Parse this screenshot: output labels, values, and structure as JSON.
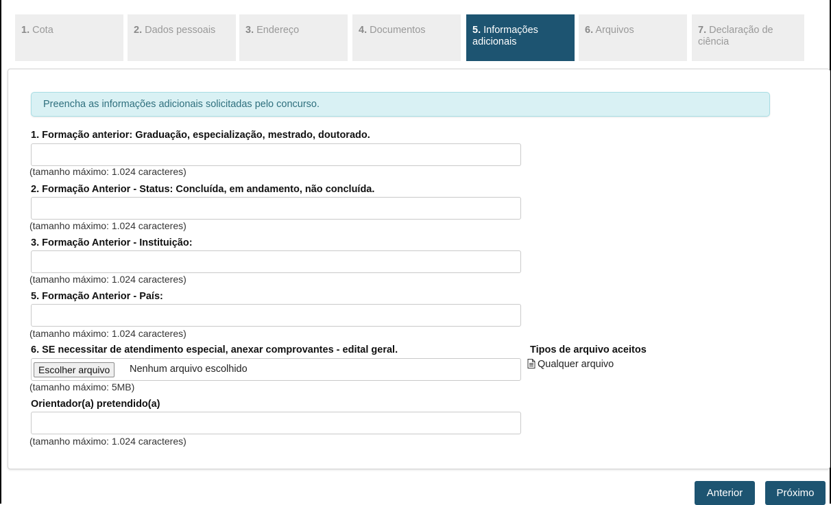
{
  "steps": [
    {
      "num": "1.",
      "label": "Cota"
    },
    {
      "num": "2.",
      "label": "Dados pessoais"
    },
    {
      "num": "3.",
      "label": "Endereço"
    },
    {
      "num": "4.",
      "label": "Documentos"
    },
    {
      "num": "5.",
      "label": "Informações adicionais"
    },
    {
      "num": "6.",
      "label": "Arquivos"
    },
    {
      "num": "7.",
      "label": "Declaração de ciência"
    }
  ],
  "info_message": "Preencha as informações adicionais solicitadas pelo concurso.",
  "fields": [
    {
      "label": "1. Formação anterior: Graduação, especialização, mestrado, doutorado.",
      "value": "",
      "hint": "(tamanho máximo: 1.024 caracteres)"
    },
    {
      "label": "2. Formação Anterior - Status: Concluída, em andamento, não concluída.",
      "value": "",
      "hint": "(tamanho máximo: 1.024 caracteres)"
    },
    {
      "label": "3. Formação Anterior - Instituição:",
      "value": "",
      "hint": "(tamanho máximo: 1.024 caracteres)"
    },
    {
      "label": "5. Formação Anterior - País:",
      "value": "",
      "hint": "(tamanho máximo: 1.024 caracteres)"
    }
  ],
  "file_field": {
    "label": "6. SE necessitar de atendimento especial, anexar comprovantes - edital geral.",
    "button": "Escolher arquivo",
    "status": "Nenhum arquivo escolhido",
    "hint": "(tamanho máximo: 5MB)",
    "types_title": "Tipos de arquivo aceitos",
    "types_item": "Qualquer arquivo",
    "types_icon": "document-icon"
  },
  "advisor_field": {
    "label": "Orientador(a) pretendido(a)",
    "value": "",
    "hint": "(tamanho máximo: 1.024 caracteres)"
  },
  "nav": {
    "previous": "Anterior",
    "next": "Próximo"
  },
  "colors": {
    "primary": "#1d5471",
    "info_bg": "#d9f1f4",
    "info_text": "#2e6f7d",
    "step_inactive_bg": "#eeeeee"
  }
}
